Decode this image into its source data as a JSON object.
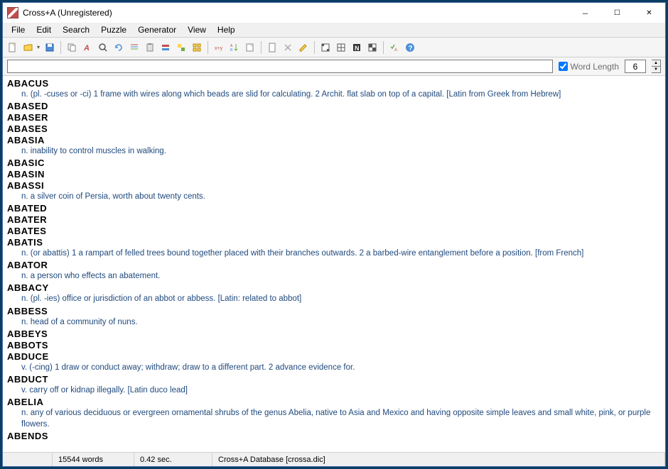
{
  "title": "Cross+A (Unregistered)",
  "menu": [
    "File",
    "Edit",
    "Search",
    "Puzzle",
    "Generator",
    "View",
    "Help"
  ],
  "search": {
    "value": "",
    "word_length_label": "Word Length",
    "word_length_value": "6",
    "word_length_checked": true
  },
  "entries": [
    {
      "word": "ABACUS",
      "def": "n. (pl. -cuses or -ci) 1 frame with wires along which beads are slid for calculating. 2 Archit. flat slab on top of a capital. [Latin from Greek from Hebrew]"
    },
    {
      "word": "ABASED",
      "def": null
    },
    {
      "word": "ABASER",
      "def": null
    },
    {
      "word": "ABASES",
      "def": null
    },
    {
      "word": "ABASIA",
      "def": "n. inability to control muscles in walking."
    },
    {
      "word": "ABASIC",
      "def": null
    },
    {
      "word": "ABASIN",
      "def": null
    },
    {
      "word": "ABASSI",
      "def": "n. a silver coin of Persia, worth about twenty cents."
    },
    {
      "word": "ABATED",
      "def": null
    },
    {
      "word": "ABATER",
      "def": null
    },
    {
      "word": "ABATES",
      "def": null
    },
    {
      "word": "ABATIS",
      "def": "n. (or abattis) 1 a rampart of felled trees bound together placed with their branches outwards. 2 a barbed-wire entanglement before a position. [from French]"
    },
    {
      "word": "ABATOR",
      "def": "n. a person who effects an abatement."
    },
    {
      "word": "ABBACY",
      "def": "n. (pl. -ies) office or jurisdiction of an abbot or abbess. [Latin: related to abbot]"
    },
    {
      "word": "ABBESS",
      "def": "n. head of a community of nuns."
    },
    {
      "word": "ABBEYS",
      "def": null
    },
    {
      "word": "ABBOTS",
      "def": null
    },
    {
      "word": "ABDUCE",
      "def": "v. (-cing) 1 draw or conduct away; withdraw; draw to a different part. 2 advance evidence for."
    },
    {
      "word": "ABDUCT",
      "def": "v. carry off or kidnap illegally. [Latin duco lead]"
    },
    {
      "word": "ABELIA",
      "def": "n. any of various deciduous or evergreen ornamental shrubs of the genus Abelia, native to Asia and Mexico and having opposite simple leaves and small white, pink, or purple flowers."
    },
    {
      "word": "ABENDS",
      "def": null
    }
  ],
  "status": {
    "count": "15544 words",
    "time": "0.42 sec.",
    "db": "Cross+A Database [crossa.dic]"
  }
}
